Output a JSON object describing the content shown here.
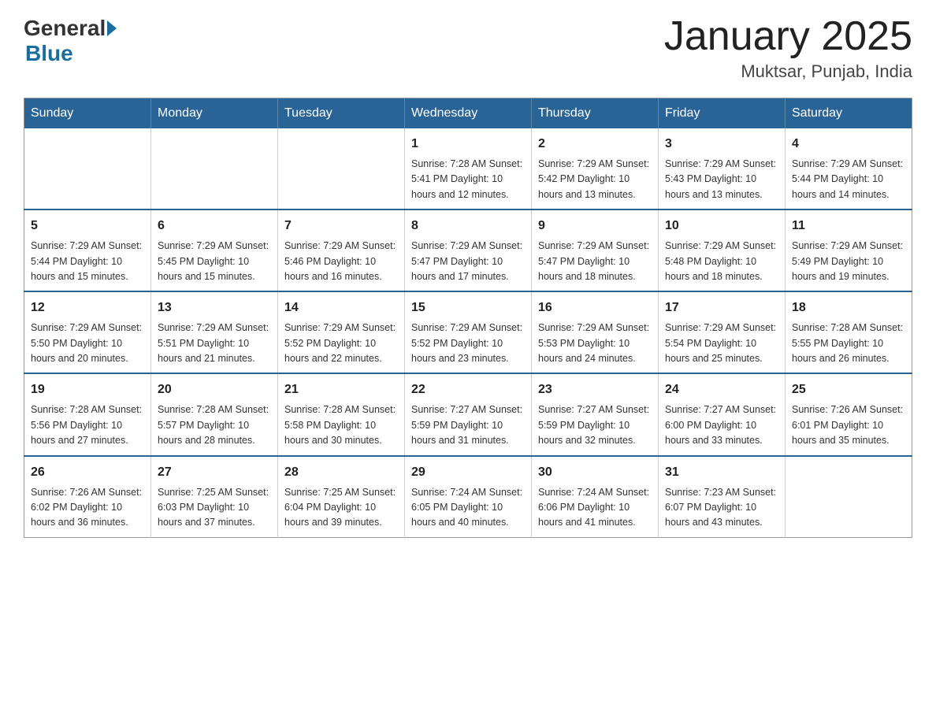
{
  "header": {
    "logo_general": "General",
    "logo_blue": "Blue",
    "title": "January 2025",
    "location": "Muktsar, Punjab, India"
  },
  "days_of_week": [
    "Sunday",
    "Monday",
    "Tuesday",
    "Wednesday",
    "Thursday",
    "Friday",
    "Saturday"
  ],
  "weeks": [
    [
      {
        "day": "",
        "info": ""
      },
      {
        "day": "",
        "info": ""
      },
      {
        "day": "",
        "info": ""
      },
      {
        "day": "1",
        "info": "Sunrise: 7:28 AM\nSunset: 5:41 PM\nDaylight: 10 hours\nand 12 minutes."
      },
      {
        "day": "2",
        "info": "Sunrise: 7:29 AM\nSunset: 5:42 PM\nDaylight: 10 hours\nand 13 minutes."
      },
      {
        "day": "3",
        "info": "Sunrise: 7:29 AM\nSunset: 5:43 PM\nDaylight: 10 hours\nand 13 minutes."
      },
      {
        "day": "4",
        "info": "Sunrise: 7:29 AM\nSunset: 5:44 PM\nDaylight: 10 hours\nand 14 minutes."
      }
    ],
    [
      {
        "day": "5",
        "info": "Sunrise: 7:29 AM\nSunset: 5:44 PM\nDaylight: 10 hours\nand 15 minutes."
      },
      {
        "day": "6",
        "info": "Sunrise: 7:29 AM\nSunset: 5:45 PM\nDaylight: 10 hours\nand 15 minutes."
      },
      {
        "day": "7",
        "info": "Sunrise: 7:29 AM\nSunset: 5:46 PM\nDaylight: 10 hours\nand 16 minutes."
      },
      {
        "day": "8",
        "info": "Sunrise: 7:29 AM\nSunset: 5:47 PM\nDaylight: 10 hours\nand 17 minutes."
      },
      {
        "day": "9",
        "info": "Sunrise: 7:29 AM\nSunset: 5:47 PM\nDaylight: 10 hours\nand 18 minutes."
      },
      {
        "day": "10",
        "info": "Sunrise: 7:29 AM\nSunset: 5:48 PM\nDaylight: 10 hours\nand 18 minutes."
      },
      {
        "day": "11",
        "info": "Sunrise: 7:29 AM\nSunset: 5:49 PM\nDaylight: 10 hours\nand 19 minutes."
      }
    ],
    [
      {
        "day": "12",
        "info": "Sunrise: 7:29 AM\nSunset: 5:50 PM\nDaylight: 10 hours\nand 20 minutes."
      },
      {
        "day": "13",
        "info": "Sunrise: 7:29 AM\nSunset: 5:51 PM\nDaylight: 10 hours\nand 21 minutes."
      },
      {
        "day": "14",
        "info": "Sunrise: 7:29 AM\nSunset: 5:52 PM\nDaylight: 10 hours\nand 22 minutes."
      },
      {
        "day": "15",
        "info": "Sunrise: 7:29 AM\nSunset: 5:52 PM\nDaylight: 10 hours\nand 23 minutes."
      },
      {
        "day": "16",
        "info": "Sunrise: 7:29 AM\nSunset: 5:53 PM\nDaylight: 10 hours\nand 24 minutes."
      },
      {
        "day": "17",
        "info": "Sunrise: 7:29 AM\nSunset: 5:54 PM\nDaylight: 10 hours\nand 25 minutes."
      },
      {
        "day": "18",
        "info": "Sunrise: 7:28 AM\nSunset: 5:55 PM\nDaylight: 10 hours\nand 26 minutes."
      }
    ],
    [
      {
        "day": "19",
        "info": "Sunrise: 7:28 AM\nSunset: 5:56 PM\nDaylight: 10 hours\nand 27 minutes."
      },
      {
        "day": "20",
        "info": "Sunrise: 7:28 AM\nSunset: 5:57 PM\nDaylight: 10 hours\nand 28 minutes."
      },
      {
        "day": "21",
        "info": "Sunrise: 7:28 AM\nSunset: 5:58 PM\nDaylight: 10 hours\nand 30 minutes."
      },
      {
        "day": "22",
        "info": "Sunrise: 7:27 AM\nSunset: 5:59 PM\nDaylight: 10 hours\nand 31 minutes."
      },
      {
        "day": "23",
        "info": "Sunrise: 7:27 AM\nSunset: 5:59 PM\nDaylight: 10 hours\nand 32 minutes."
      },
      {
        "day": "24",
        "info": "Sunrise: 7:27 AM\nSunset: 6:00 PM\nDaylight: 10 hours\nand 33 minutes."
      },
      {
        "day": "25",
        "info": "Sunrise: 7:26 AM\nSunset: 6:01 PM\nDaylight: 10 hours\nand 35 minutes."
      }
    ],
    [
      {
        "day": "26",
        "info": "Sunrise: 7:26 AM\nSunset: 6:02 PM\nDaylight: 10 hours\nand 36 minutes."
      },
      {
        "day": "27",
        "info": "Sunrise: 7:25 AM\nSunset: 6:03 PM\nDaylight: 10 hours\nand 37 minutes."
      },
      {
        "day": "28",
        "info": "Sunrise: 7:25 AM\nSunset: 6:04 PM\nDaylight: 10 hours\nand 39 minutes."
      },
      {
        "day": "29",
        "info": "Sunrise: 7:24 AM\nSunset: 6:05 PM\nDaylight: 10 hours\nand 40 minutes."
      },
      {
        "day": "30",
        "info": "Sunrise: 7:24 AM\nSunset: 6:06 PM\nDaylight: 10 hours\nand 41 minutes."
      },
      {
        "day": "31",
        "info": "Sunrise: 7:23 AM\nSunset: 6:07 PM\nDaylight: 10 hours\nand 43 minutes."
      },
      {
        "day": "",
        "info": ""
      }
    ]
  ]
}
